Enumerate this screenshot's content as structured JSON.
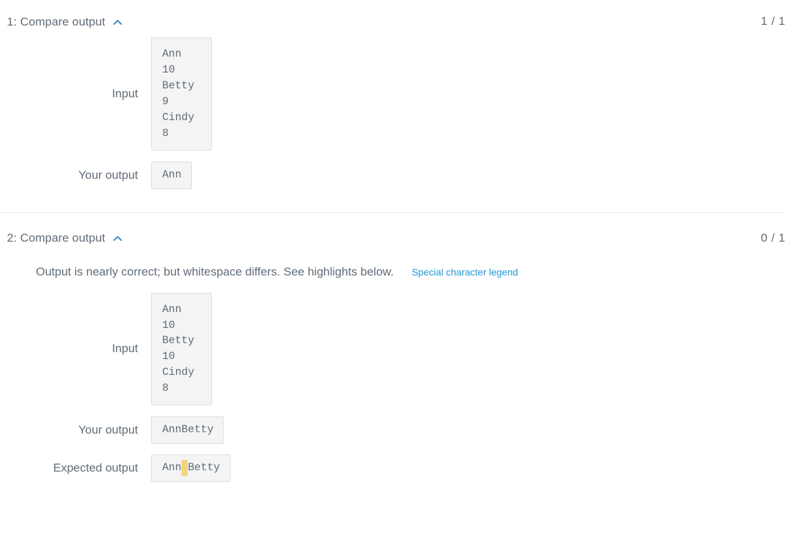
{
  "testcases": [
    {
      "title": "1: Compare output",
      "collapse_icon": "chevron-up-icon",
      "score": "1 / 1",
      "message": null,
      "legend_link": null,
      "rows": [
        {
          "label": "Input",
          "value": "Ann\n10\nBetty\n9\nCindy\n8",
          "multiline": true
        },
        {
          "label": "Your output",
          "value": "Ann",
          "multiline": false
        }
      ]
    },
    {
      "title": "2: Compare output",
      "collapse_icon": "chevron-up-icon",
      "score": "0 / 1",
      "message": "Output is nearly correct; but whitespace differs. See highlights below.",
      "legend_link": "Special character legend",
      "rows": [
        {
          "label": "Input",
          "value": "Ann\n10\nBetty\n10\nCindy\n8",
          "multiline": true
        },
        {
          "label": "Your output",
          "value": "AnnBetty",
          "multiline": false
        },
        {
          "label": "Expected output",
          "value_before": "Ann",
          "value_highlight": " ",
          "value_after": "Betty",
          "multiline": false
        }
      ]
    }
  ],
  "colors": {
    "text": "#5f6b77",
    "link": "#2196d6",
    "box_background": "#f4f4f4",
    "box_border": "#dedede",
    "whitespace_highlight": "#f2d47d",
    "divider": "#e9eaeb"
  }
}
